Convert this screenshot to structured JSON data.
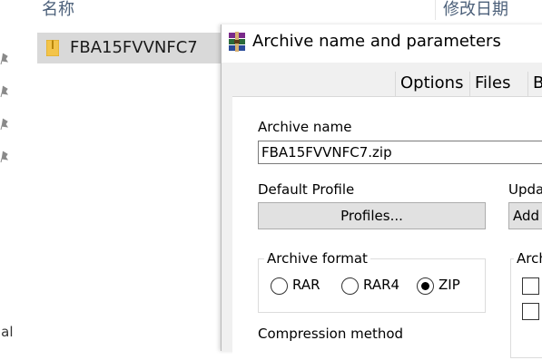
{
  "explorer": {
    "column_name": "名称",
    "column_date": "修改日期",
    "file_name": "FBA15FVVNFC7",
    "left_text": "ial"
  },
  "dialog": {
    "title": "Archive name and parameters",
    "tabs": [
      "Options",
      "Files",
      "B"
    ],
    "archive_name_label": "Archive name",
    "archive_name_value": "FBA15FVVNFC7.zip",
    "default_profile_label": "Default Profile",
    "profiles_button": "Profiles...",
    "update_label": "Upda",
    "add_button": "Add",
    "archive_format_label": "Archive format",
    "formats": [
      {
        "label": "RAR",
        "checked": false
      },
      {
        "label": "RAR4",
        "checked": false
      },
      {
        "label": "ZIP",
        "checked": true
      }
    ],
    "archiving_options_label": "Arch",
    "compression_method_label": "Compression method"
  },
  "colors": {
    "selection": "#d9d9d9",
    "dialog_bg": "#f0f0f0",
    "header_text": "#4c607a"
  }
}
